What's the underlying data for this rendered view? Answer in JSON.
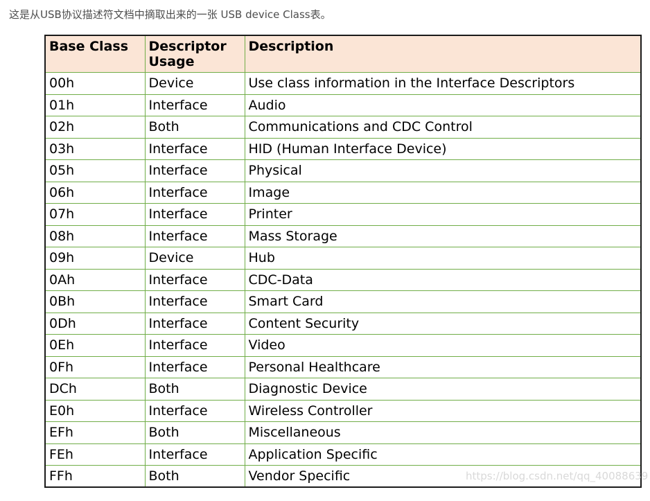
{
  "intro_text": "这是从USB协议描述符文档中摘取出来的一张 USB device Class表。",
  "table": {
    "headers": {
      "base_class": "Base Class",
      "descriptor_usage": "Descriptor Usage",
      "description": "Description"
    },
    "rows": [
      {
        "base_class": "00h",
        "usage": "Device",
        "description": "Use class information in the Interface Descriptors"
      },
      {
        "base_class": "01h",
        "usage": "Interface",
        "description": "Audio"
      },
      {
        "base_class": "02h",
        "usage": "Both",
        "description": "Communications and CDC Control"
      },
      {
        "base_class": "03h",
        "usage": "Interface",
        "description": "HID (Human Interface Device)"
      },
      {
        "base_class": "05h",
        "usage": "Interface",
        "description": "Physical"
      },
      {
        "base_class": "06h",
        "usage": "Interface",
        "description": "Image"
      },
      {
        "base_class": "07h",
        "usage": "Interface",
        "description": "Printer"
      },
      {
        "base_class": "08h",
        "usage": "Interface",
        "description": "Mass Storage"
      },
      {
        "base_class": "09h",
        "usage": "Device",
        "description": "Hub"
      },
      {
        "base_class": "0Ah",
        "usage": "Interface",
        "description": "CDC-Data"
      },
      {
        "base_class": "0Bh",
        "usage": "Interface",
        "description": "Smart Card"
      },
      {
        "base_class": "0Dh",
        "usage": "Interface",
        "description": "Content Security"
      },
      {
        "base_class": "0Eh",
        "usage": "Interface",
        "description": "Video"
      },
      {
        "base_class": "0Fh",
        "usage": "Interface",
        "description": "Personal Healthcare"
      },
      {
        "base_class": "DCh",
        "usage": "Both",
        "description": "Diagnostic Device"
      },
      {
        "base_class": "E0h",
        "usage": "Interface",
        "description": "Wireless Controller"
      },
      {
        "base_class": "EFh",
        "usage": "Both",
        "description": "Miscellaneous"
      },
      {
        "base_class": "FEh",
        "usage": "Interface",
        "description": "Application Specific"
      },
      {
        "base_class": "FFh",
        "usage": "Both",
        "description": "Vendor Specific"
      }
    ]
  },
  "watermark": "https://blog.csdn.net/qq_40088639",
  "colors": {
    "header_background": "#fbe5d6",
    "grid_line": "#70ad47",
    "outer_border": "#1a1a1a",
    "intro_text": "#4d4d4d"
  }
}
